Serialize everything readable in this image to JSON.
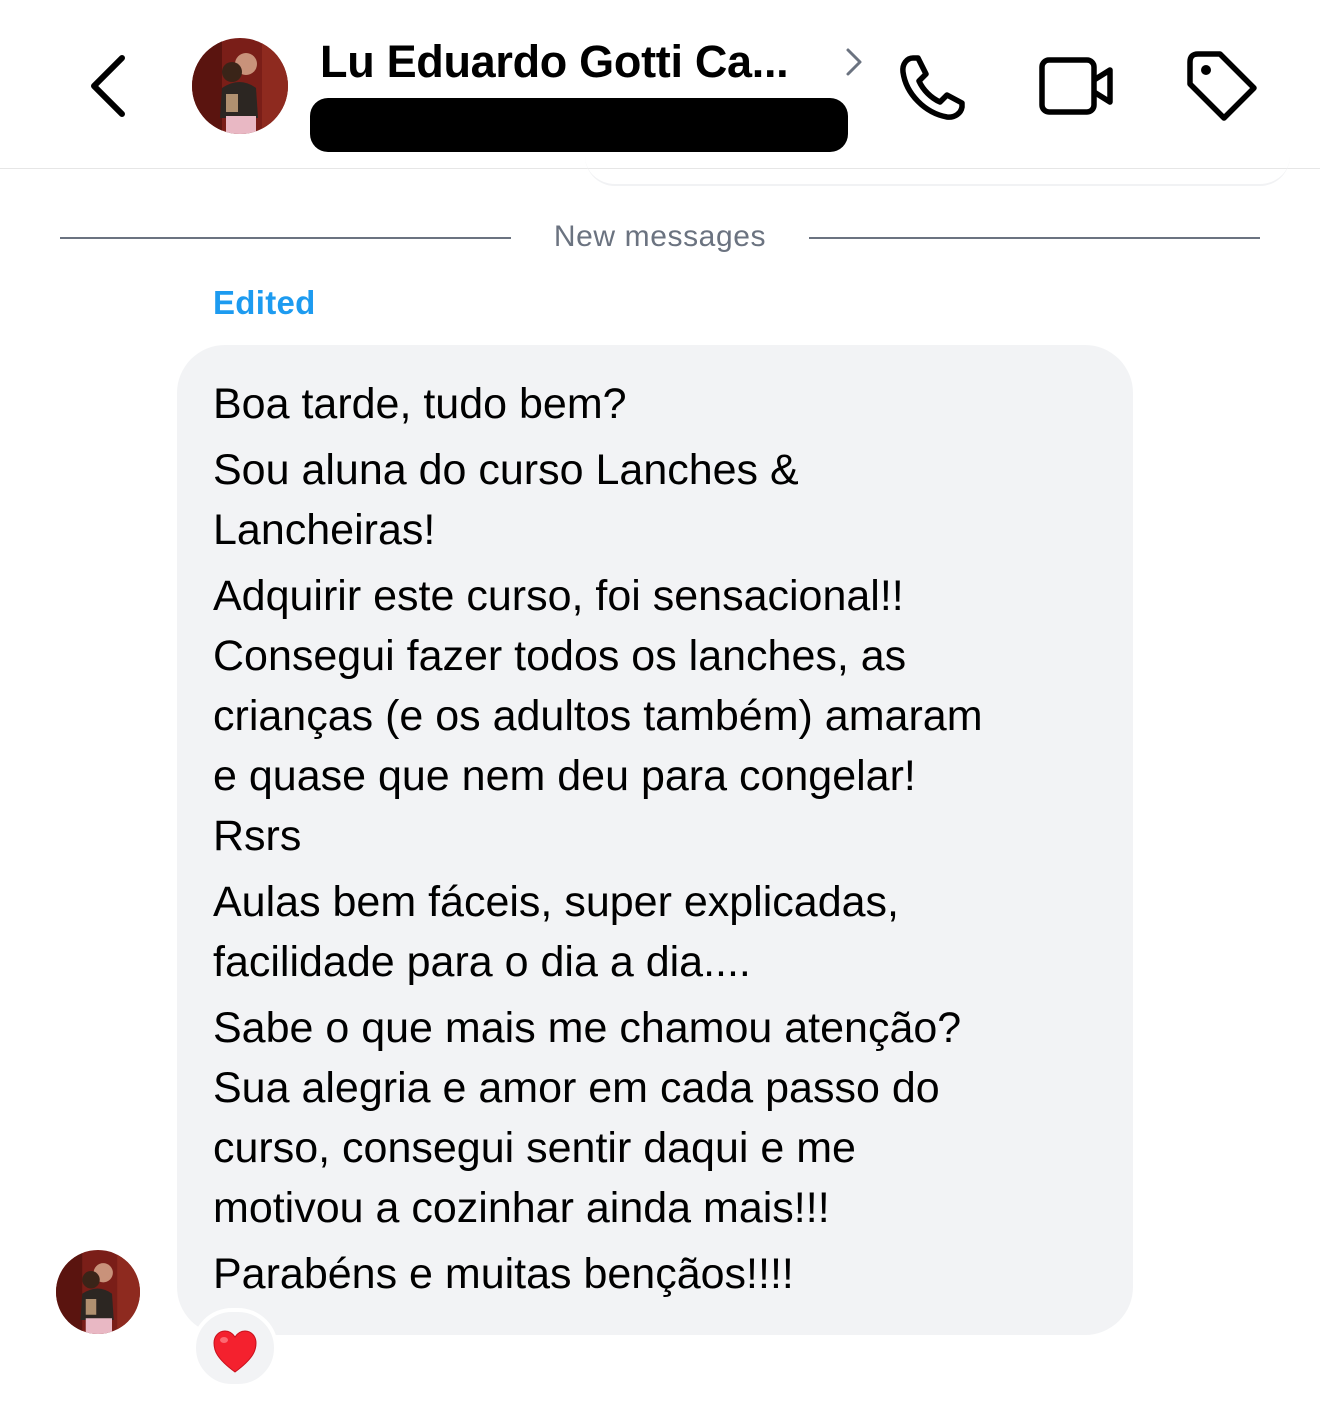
{
  "header": {
    "contact_name": "Lu Eduardo Gotti Ca...",
    "icons": {
      "back": "chevron-left-icon",
      "name_chevron": "chevron-right-icon",
      "call": "phone-icon",
      "video": "video-camera-icon",
      "label": "tag-icon"
    }
  },
  "divider": {
    "label": "New messages"
  },
  "message": {
    "edited_label": "Edited",
    "lines": [
      "Boa tarde, tudo bem?",
      "Sou aluna do curso Lanches &",
      "Lancheiras!",
      "Adquirir este curso, foi sensacional!!",
      "Consegui fazer todos os lanches, as",
      "crianças (e os adultos também) amaram",
      "e quase que nem deu para congelar!",
      "Rsrs",
      "Aulas bem fáceis, super explicadas,",
      "facilidade para o dia a dia....",
      "Sabe o que mais me chamou atenção?",
      "Sua alegria e amor em cada passo do",
      "curso, consegui sentir daqui e me",
      "motivou a cozinhar ainda mais!!!",
      "Parabéns e muitas bençãos!!!!"
    ],
    "reaction": "❤️"
  },
  "colors": {
    "accent_blue": "#1d9bf0",
    "bubble_bg": "#f2f3f5",
    "divider_gray": "#6b7380",
    "heart_red": "#f4212e"
  }
}
